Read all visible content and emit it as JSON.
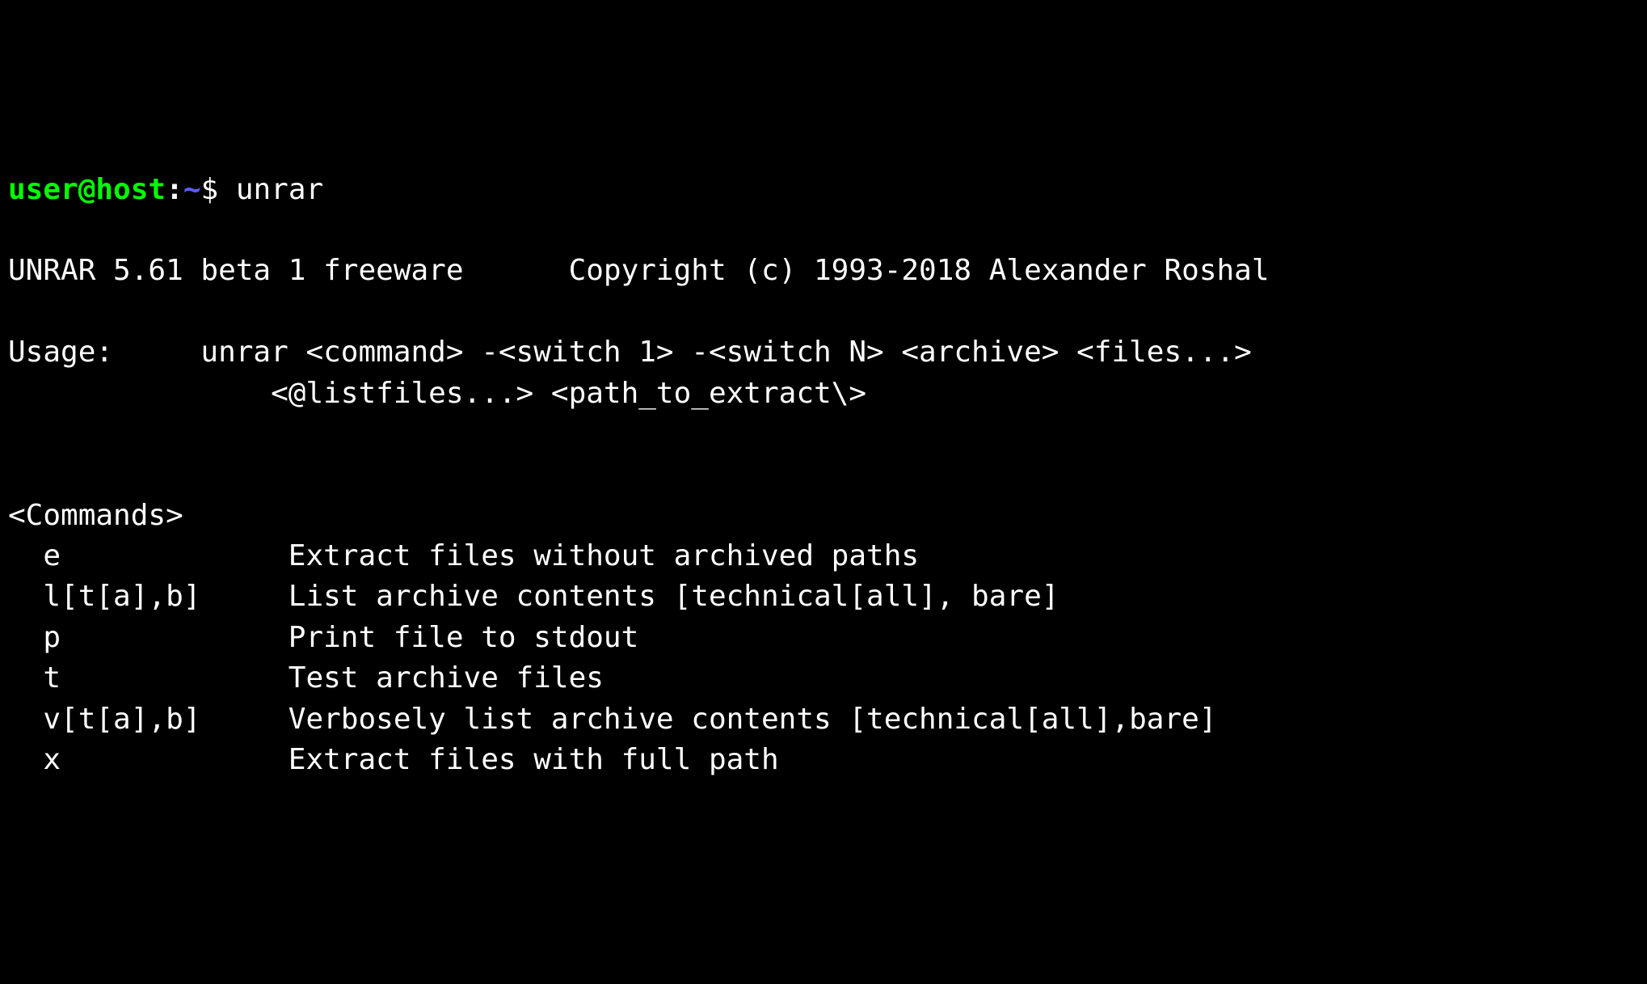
{
  "prompt": {
    "user": "user@host",
    "colon": ":",
    "path": "~",
    "dollar": "$",
    "command": "unrar"
  },
  "output": {
    "blank1": "",
    "header": "UNRAR 5.61 beta 1 freeware      Copyright (c) 1993-2018 Alexander Roshal",
    "blank2": "",
    "usage1": "Usage:     unrar <command> -<switch 1> -<switch N> <archive> <files...>",
    "usage2": "               <@listfiles...> <path_to_extract\\>",
    "blank3": "",
    "blank4": "",
    "commandsHeader": "<Commands>",
    "cmd_e": "  e             Extract files without archived paths",
    "cmd_l": "  l[t[a],b]     List archive contents [technical[all], bare]",
    "cmd_p": "  p             Print file to stdout",
    "cmd_t": "  t             Test archive files",
    "cmd_v": "  v[t[a],b]     Verbosely list archive contents [technical[all],bare]",
    "cmd_x": "  x             Extract files with full path"
  }
}
